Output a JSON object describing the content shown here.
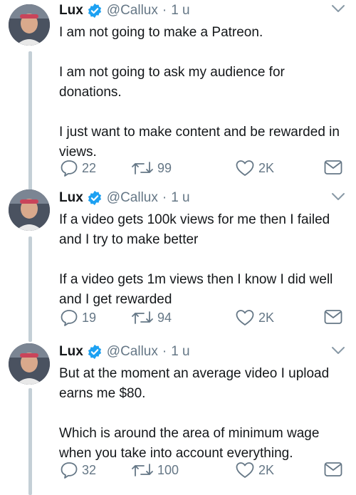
{
  "tweets": [
    {
      "name": "Lux",
      "handle": "@Callux",
      "separator": "·",
      "time": "1 u",
      "paragraphs": [
        "I am not going to make a Patreon.",
        "I am not going to ask my audience for donations.",
        "I just want to make content and be rewarded in views."
      ],
      "replies": "22",
      "retweets": "99",
      "likes": "2K"
    },
    {
      "name": "Lux",
      "handle": "@Callux",
      "separator": "·",
      "time": "1 u",
      "paragraphs": [
        "If a video gets 100k views for me then I failed and I try to make better",
        "If a video gets 1m views then I know I did well and I get rewarded"
      ],
      "replies": "19",
      "retweets": "94",
      "likes": "2K"
    },
    {
      "name": "Lux",
      "handle": "@Callux",
      "separator": "·",
      "time": "1 u",
      "paragraphs": [
        "But at the moment an average video I upload earns me $80.",
        "Which is around the area of minimum wage when you take into account everything."
      ],
      "replies": "32",
      "retweets": "100",
      "likes": "2K"
    }
  ],
  "colors": {
    "verified": "#1da1f2",
    "muted": "#657786",
    "thread_line": "#c4cfd6"
  },
  "icons": [
    "verified-badge-icon",
    "chevron-down-icon",
    "reply-icon",
    "retweet-icon",
    "like-icon",
    "direct-message-icon"
  ]
}
